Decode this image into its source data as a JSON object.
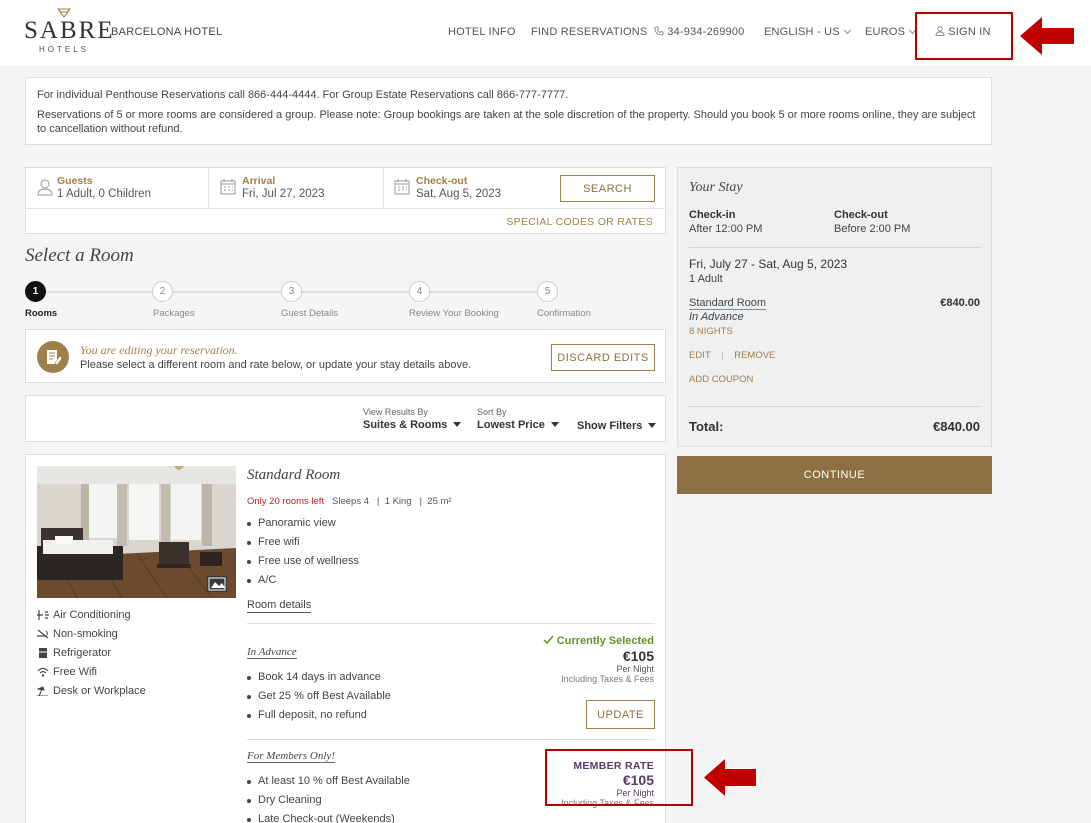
{
  "header": {
    "logo_brand": "SABRE",
    "logo_sub": "HOTELS",
    "hotel_name": "BARCELONA HOTEL",
    "nav": {
      "hotel_info": "HOTEL INFO",
      "find_reservations": "FIND RESERVATIONS",
      "phone": "34-934-269900",
      "language": "ENGLISH - US",
      "currency": "EUROS",
      "sign_in": "SIGN IN"
    }
  },
  "notice": {
    "line1": "For individual Penthouse Reservations call 866-444-4444. For Group Estate Reservations call 866-777-7777.",
    "line2": "Reservations of 5 or more rooms are considered a group. Please note: Group bookings are taken at the sole discretion of the property. Should you book 5 or more rooms online, they are subject to cancellation without refund."
  },
  "search": {
    "guests_label": "Guests",
    "guests_value": "1 Adult, 0 Children",
    "arrival_label": "Arrival",
    "arrival_value": "Fri, Jul 27, 2023",
    "checkout_label": "Check-out",
    "checkout_value": "Sat, Aug 5, 2023",
    "search_button": "SEARCH",
    "special_codes": "SPECIAL CODES OR RATES"
  },
  "select_room": {
    "title": "Select a Room",
    "steps": [
      {
        "num": "1",
        "label": "Rooms"
      },
      {
        "num": "2",
        "label": "Packages"
      },
      {
        "num": "3",
        "label": "Guest Details"
      },
      {
        "num": "4",
        "label": "Review Your Booking"
      },
      {
        "num": "5",
        "label": "Confirmation"
      }
    ]
  },
  "edit": {
    "title": "You are editing your reservation.",
    "message": "Please select a different room and rate below, or update your stay details above.",
    "discard_button": "DISCARD EDITS"
  },
  "filters": {
    "view_label": "View Results By",
    "view_value": "Suites & Rooms",
    "sort_label": "Sort By",
    "sort_value": "Lowest Price",
    "show_filters": "Show Filters"
  },
  "room": {
    "name": "Standard Room",
    "rooms_left": "Only 20 rooms left",
    "sleeps": "Sleeps 4",
    "bed": "1 King",
    "size": "25 m²",
    "features": [
      "Panoramic view",
      "Free wifi",
      "Free use of wellness",
      "A/C"
    ],
    "details_link": "Room details",
    "amenities": [
      "Air Conditioning",
      "Non-smoking",
      "Refrigerator",
      "Free Wifi",
      "Desk or Workplace"
    ],
    "rates": [
      {
        "name": "In Advance",
        "status": "Currently Selected",
        "price": "€105",
        "per": "Per Night",
        "taxes": "Including Taxes & Fees",
        "bullets": [
          "Book 14 days in advance",
          "Get 25 % off Best Available",
          "Full deposit, no refund"
        ],
        "button": "UPDATE"
      },
      {
        "name": "For Members Only!",
        "status": "MEMBER RATE",
        "price": "€105",
        "per": "Per Night",
        "taxes": "Including Taxes & Fees",
        "bullets": [
          "At least 10 % off Best Available",
          "Dry Cleaning",
          "Late Check-out (Weekends)"
        ]
      }
    ]
  },
  "stay": {
    "title": "Your Stay",
    "checkin_label": "Check-in",
    "checkin_value": "After 12:00 PM",
    "checkout_label": "Check-out",
    "checkout_value": "Before 2:00 PM",
    "dates": "Fri, July 27 - Sat, Aug 5, 2023",
    "guests": "1 Adult",
    "room_name": "Standard Room",
    "rate_name": "In Advance",
    "nights": "8 NIGHTS",
    "room_price": "€840.00",
    "edit": "EDIT",
    "remove": "REMOVE",
    "add_coupon": "ADD COUPON",
    "total_label": "Total:",
    "total_value": "€840.00",
    "continue_button": "CONTINUE"
  },
  "colors": {
    "gold": "#a0804a",
    "continue_bg": "#8d7041",
    "selected_green": "#6a8f2a",
    "member_purple": "#5a3a66",
    "annotation_red": "#b30000"
  }
}
